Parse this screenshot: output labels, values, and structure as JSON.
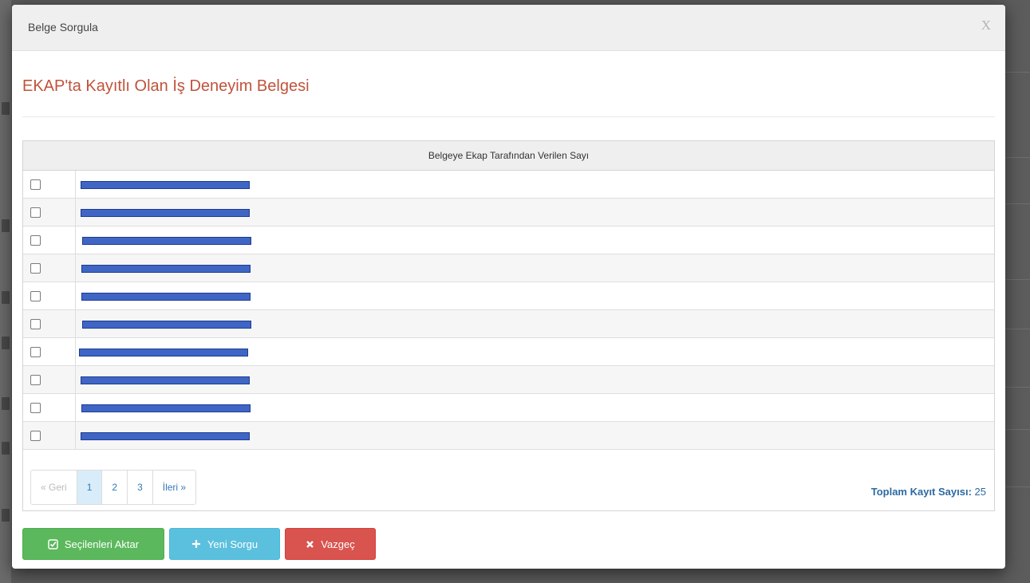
{
  "modal": {
    "title": "Belge Sorgula",
    "close_label": "X"
  },
  "section_title": "EKAP'ta Kayıtlı Olan İş Deneyim Belgesi",
  "grid": {
    "column_header": "Belgeye Ekap Tarafından Verilen Sayı",
    "rows": [
      {
        "value": "",
        "redacted": true
      },
      {
        "value": "",
        "redacted": true
      },
      {
        "value": "",
        "redacted": true
      },
      {
        "value": "",
        "redacted": true
      },
      {
        "value": "",
        "redacted": true
      },
      {
        "value": "",
        "redacted": true
      },
      {
        "value": "",
        "redacted": true
      },
      {
        "value": "",
        "redacted": true
      },
      {
        "value": "",
        "redacted": true
      },
      {
        "value": "",
        "redacted": true
      }
    ]
  },
  "pagination": {
    "prev": "« Geri",
    "pages": [
      "1",
      "2",
      "3"
    ],
    "current_page": "1",
    "next": "İleri »"
  },
  "total": {
    "label": "Toplam Kayıt Sayısı:",
    "value": "25"
  },
  "buttons": {
    "transfer": "Seçilenleri Aktar",
    "new_query": "Yeni Sorgu",
    "cancel": "Vazgeç"
  },
  "colors": {
    "section_title": "#c0533b",
    "transfer_button": "#5cb85c",
    "new_query_button": "#5bc0de",
    "cancel_button": "#d9534f",
    "redaction": "#3f66c4"
  }
}
